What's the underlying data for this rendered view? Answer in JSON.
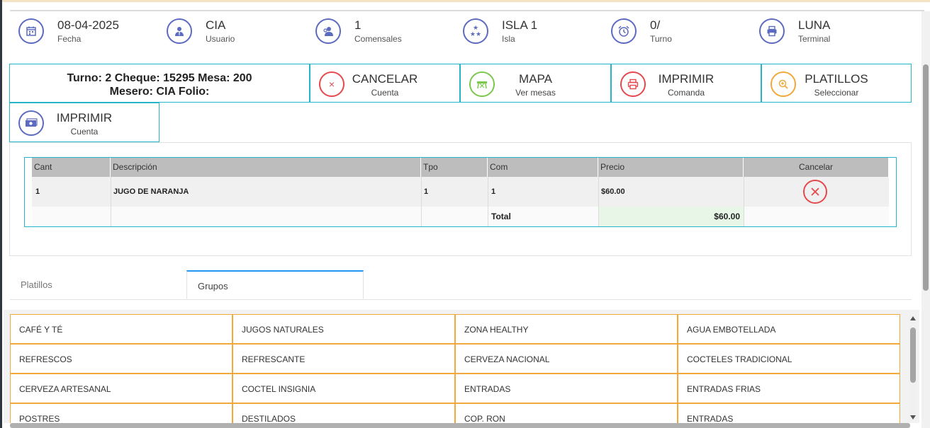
{
  "info": [
    {
      "value": "08-04-2025",
      "label": "Fecha",
      "icon": "calendar-icon"
    },
    {
      "value": "CIA",
      "label": "Usuario",
      "icon": "user-tie-icon"
    },
    {
      "value": "1",
      "label": "Comensales",
      "icon": "guests-icon"
    },
    {
      "value": "ISLA 1",
      "label": "Isla",
      "icon": "stars-icon"
    },
    {
      "value": "0/",
      "label": "Turno",
      "icon": "alarm-clock-icon"
    },
    {
      "value": "LUNA",
      "label": "Terminal",
      "icon": "printer-icon"
    }
  ],
  "ticket": {
    "line1": "Turno: 2 Cheque: 15295 Mesa: 200",
    "line2": "Mesero: CIA Folio:"
  },
  "actions": [
    {
      "title": "CANCELAR",
      "sub": "Cuenta",
      "icon": "close-icon",
      "color": "#e5484d"
    },
    {
      "title": "MAPA",
      "sub": "Ver mesas",
      "icon": "table-map-icon",
      "color": "#7cc84f"
    },
    {
      "title": "IMPRIMIR",
      "sub": "Comanda",
      "icon": "printer-icon",
      "color": "#e5484d"
    },
    {
      "title": "PLATILLOS",
      "sub": "Seleccionar",
      "icon": "zoom-in-icon",
      "color": "#f2a83a"
    },
    {
      "title": "IMPRIMIR",
      "sub": "Cuenta",
      "icon": "cash-icon",
      "color": "#5c6bc0"
    }
  ],
  "table": {
    "headers": [
      "Cant",
      "Descripción",
      "Tpo",
      "Com",
      "Precio",
      "Cancelar"
    ],
    "row": {
      "cant": "1",
      "descripcion": "JUGO DE NARANJA",
      "tpo": "1",
      "com": "1",
      "precio": "$60.00"
    },
    "total_label": "Total",
    "total_value": "$60.00"
  },
  "tabs": [
    "Platillos",
    "Grupos"
  ],
  "groups": [
    "CAFÉ Y TÉ",
    "JUGOS NATURALES",
    "ZONA HEALTHY",
    "AGUA EMBOTELLADA",
    "REFRESCOS",
    "REFRESCANTE",
    "CERVEZA NACIONAL",
    "COCTELES TRADICIONAL",
    "CERVEZA ARTESANAL",
    "COCTEL INSIGNIA",
    "ENTRADAS",
    "ENTRADAS FRIAS",
    "POSTRES",
    "DESTILADOS",
    "COP. RON",
    "ENTRADAS"
  ]
}
